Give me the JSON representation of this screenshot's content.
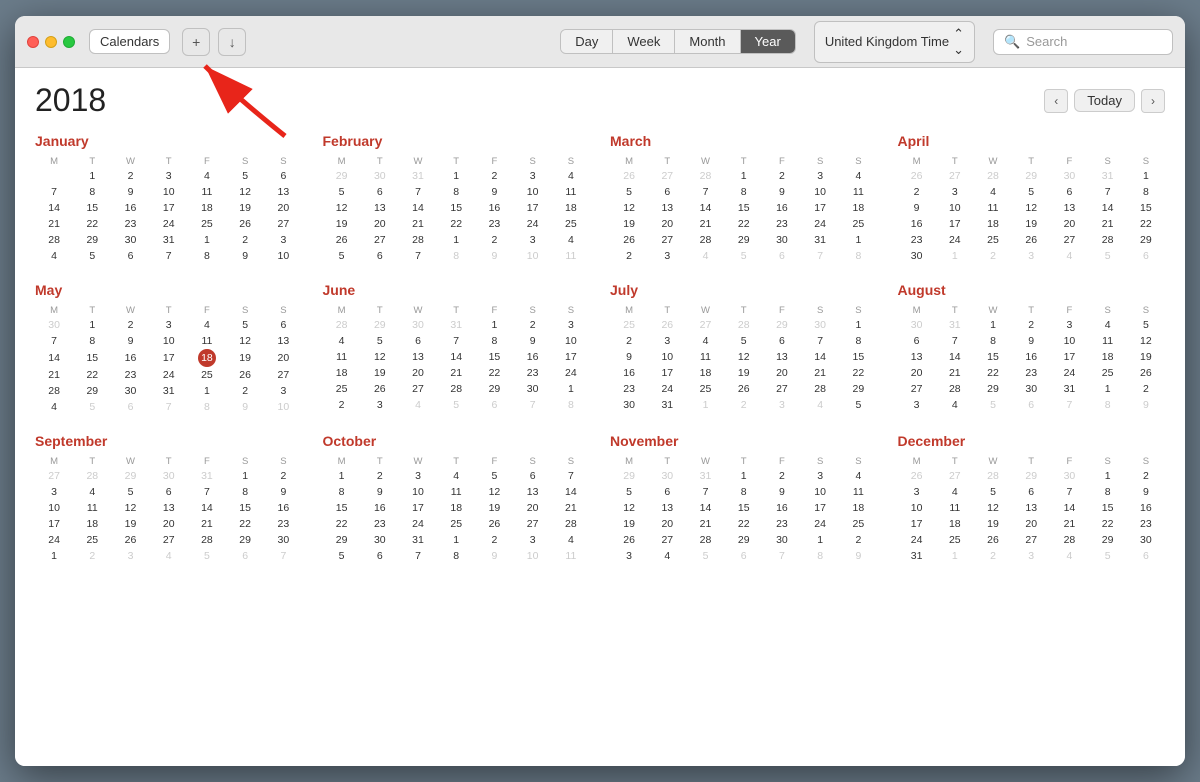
{
  "titlebar": {
    "calendars_label": "Calendars",
    "view_tabs": [
      "Day",
      "Week",
      "Month",
      "Year"
    ],
    "active_tab": "Year",
    "timezone_label": "United Kingdom Time",
    "search_placeholder": "Search"
  },
  "year": "2018",
  "nav": {
    "today_label": "Today"
  },
  "months": [
    {
      "name": "January",
      "days_header": [
        "M",
        "T",
        "W",
        "T",
        "F",
        "S",
        "S"
      ],
      "weeks": [
        [
          "",
          "1",
          "2",
          "3",
          "4",
          "5",
          "6"
        ],
        [
          "7",
          "8",
          "9",
          "10",
          "11",
          "12",
          "13"
        ],
        [
          "14",
          "15",
          "16",
          "17",
          "18",
          "19",
          "20"
        ],
        [
          "21",
          "22",
          "23",
          "24",
          "25",
          "26",
          "27"
        ],
        [
          "28",
          "29",
          "30",
          "31",
          "1",
          "2",
          "3"
        ],
        [
          "4",
          "5",
          "6",
          "7",
          "8",
          "9",
          "10"
        ]
      ],
      "other_month_before": [],
      "other_month_after": [
        "1",
        "2",
        "3",
        "4",
        "5",
        "6",
        "7",
        "8",
        "9",
        "10"
      ]
    },
    {
      "name": "February",
      "days_header": [
        "M",
        "T",
        "W",
        "T",
        "F",
        "S",
        "S"
      ],
      "weeks": [
        [
          "29",
          "30",
          "31",
          "1",
          "2",
          "3",
          "4"
        ],
        [
          "5",
          "6",
          "7",
          "8",
          "9",
          "10",
          "11"
        ],
        [
          "12",
          "13",
          "14",
          "15",
          "16",
          "17",
          "18"
        ],
        [
          "19",
          "20",
          "21",
          "22",
          "23",
          "24",
          "25"
        ],
        [
          "26",
          "27",
          "28",
          "1",
          "2",
          "3",
          "4"
        ],
        [
          "5",
          "6",
          "7",
          "8",
          "9",
          "10",
          "11"
        ]
      ]
    },
    {
      "name": "March",
      "days_header": [
        "M",
        "T",
        "W",
        "T",
        "F",
        "S",
        "S"
      ],
      "weeks": [
        [
          "26",
          "27",
          "28",
          "1",
          "2",
          "3",
          "4"
        ],
        [
          "5",
          "6",
          "7",
          "8",
          "9",
          "10",
          "11"
        ],
        [
          "12",
          "13",
          "14",
          "15",
          "16",
          "17",
          "18"
        ],
        [
          "19",
          "20",
          "21",
          "22",
          "23",
          "24",
          "25"
        ],
        [
          "26",
          "27",
          "28",
          "29",
          "30",
          "31",
          "1"
        ],
        [
          "2",
          "3",
          "4",
          "5",
          "6",
          "7",
          "8"
        ]
      ]
    },
    {
      "name": "April",
      "days_header": [
        "M",
        "T",
        "W",
        "T",
        "F",
        "S",
        "S"
      ],
      "weeks": [
        [
          "26",
          "27",
          "28",
          "29",
          "30",
          "31",
          "1"
        ],
        [
          "2",
          "3",
          "4",
          "5",
          "6",
          "7",
          "8"
        ],
        [
          "9",
          "10",
          "11",
          "12",
          "13",
          "14",
          "15"
        ],
        [
          "16",
          "17",
          "18",
          "19",
          "20",
          "21",
          "22"
        ],
        [
          "23",
          "24",
          "25",
          "26",
          "27",
          "28",
          "29"
        ],
        [
          "30",
          "1",
          "2",
          "3",
          "4",
          "5",
          "6"
        ]
      ]
    },
    {
      "name": "May",
      "days_header": [
        "M",
        "T",
        "W",
        "T",
        "F",
        "S",
        "S"
      ],
      "weeks": [
        [
          "30",
          "1",
          "2",
          "3",
          "4",
          "5",
          "6"
        ],
        [
          "7",
          "8",
          "9",
          "10",
          "11",
          "12",
          "13"
        ],
        [
          "14",
          "15",
          "16",
          "17",
          "18",
          "19",
          "20"
        ],
        [
          "21",
          "22",
          "23",
          "24",
          "25",
          "26",
          "27"
        ],
        [
          "28",
          "29",
          "30",
          "31",
          "1",
          "2",
          "3"
        ],
        [
          "4",
          "5",
          "6",
          "7",
          "8",
          "9",
          "10"
        ]
      ]
    },
    {
      "name": "June",
      "days_header": [
        "M",
        "T",
        "W",
        "T",
        "F",
        "S",
        "S"
      ],
      "weeks": [
        [
          "28",
          "29",
          "30",
          "31",
          "1",
          "2",
          "3"
        ],
        [
          "4",
          "5",
          "6",
          "7",
          "8",
          "9",
          "10"
        ],
        [
          "11",
          "12",
          "13",
          "14",
          "15",
          "16",
          "17"
        ],
        [
          "18",
          "19",
          "20",
          "21",
          "22",
          "23",
          "24"
        ],
        [
          "25",
          "26",
          "27",
          "28",
          "29",
          "30",
          "1"
        ],
        [
          "2",
          "3",
          "4",
          "5",
          "6",
          "7",
          "8"
        ]
      ]
    },
    {
      "name": "July",
      "days_header": [
        "M",
        "T",
        "W",
        "T",
        "F",
        "S",
        "S"
      ],
      "weeks": [
        [
          "25",
          "26",
          "27",
          "28",
          "29",
          "30",
          "1"
        ],
        [
          "2",
          "3",
          "4",
          "5",
          "6",
          "7",
          "8"
        ],
        [
          "9",
          "10",
          "11",
          "12",
          "13",
          "14",
          "15"
        ],
        [
          "16",
          "17",
          "18",
          "19",
          "20",
          "21",
          "22"
        ],
        [
          "23",
          "24",
          "25",
          "26",
          "27",
          "28",
          "29"
        ],
        [
          "30",
          "31",
          "1",
          "2",
          "3",
          "4",
          "5"
        ]
      ]
    },
    {
      "name": "August",
      "days_header": [
        "M",
        "T",
        "W",
        "T",
        "F",
        "S",
        "S"
      ],
      "weeks": [
        [
          "30",
          "31",
          "1",
          "2",
          "3",
          "4",
          "5"
        ],
        [
          "6",
          "7",
          "8",
          "9",
          "10",
          "11",
          "12"
        ],
        [
          "13",
          "14",
          "15",
          "16",
          "17",
          "18",
          "19"
        ],
        [
          "20",
          "21",
          "22",
          "23",
          "24",
          "25",
          "26"
        ],
        [
          "27",
          "28",
          "29",
          "30",
          "31",
          "1",
          "2"
        ],
        [
          "3",
          "4",
          "5",
          "6",
          "7",
          "8",
          "9"
        ]
      ]
    },
    {
      "name": "September",
      "days_header": [
        "M",
        "T",
        "W",
        "T",
        "F",
        "S",
        "S"
      ],
      "weeks": [
        [
          "27",
          "28",
          "29",
          "30",
          "31",
          "1",
          "2"
        ],
        [
          "3",
          "4",
          "5",
          "6",
          "7",
          "8",
          "9"
        ],
        [
          "10",
          "11",
          "12",
          "13",
          "14",
          "15",
          "16"
        ],
        [
          "17",
          "18",
          "19",
          "20",
          "21",
          "22",
          "23"
        ],
        [
          "24",
          "25",
          "26",
          "27",
          "28",
          "29",
          "30"
        ],
        [
          "1",
          "2",
          "3",
          "4",
          "5",
          "6",
          "7"
        ]
      ]
    },
    {
      "name": "October",
      "days_header": [
        "M",
        "T",
        "W",
        "T",
        "F",
        "S",
        "S"
      ],
      "weeks": [
        [
          "1",
          "2",
          "3",
          "4",
          "5",
          "6",
          "7"
        ],
        [
          "8",
          "9",
          "10",
          "11",
          "12",
          "13",
          "14"
        ],
        [
          "15",
          "16",
          "17",
          "18",
          "19",
          "20",
          "21"
        ],
        [
          "22",
          "23",
          "24",
          "25",
          "26",
          "27",
          "28"
        ],
        [
          "29",
          "30",
          "31",
          "1",
          "2",
          "3",
          "4"
        ],
        [
          "5",
          "6",
          "7",
          "8",
          "9",
          "10",
          "11"
        ]
      ]
    },
    {
      "name": "November",
      "days_header": [
        "M",
        "T",
        "W",
        "T",
        "F",
        "S",
        "S"
      ],
      "weeks": [
        [
          "29",
          "30",
          "31",
          "1",
          "2",
          "3",
          "4"
        ],
        [
          "5",
          "6",
          "7",
          "8",
          "9",
          "10",
          "11"
        ],
        [
          "12",
          "13",
          "14",
          "15",
          "16",
          "17",
          "18"
        ],
        [
          "19",
          "20",
          "21",
          "22",
          "23",
          "24",
          "25"
        ],
        [
          "26",
          "27",
          "28",
          "29",
          "30",
          "1",
          "2"
        ],
        [
          "3",
          "4",
          "5",
          "6",
          "7",
          "8",
          "9"
        ]
      ]
    },
    {
      "name": "December",
      "days_header": [
        "M",
        "T",
        "W",
        "T",
        "F",
        "S",
        "S"
      ],
      "weeks": [
        [
          "26",
          "27",
          "28",
          "29",
          "30",
          "1",
          "2"
        ],
        [
          "3",
          "4",
          "5",
          "6",
          "7",
          "8",
          "9"
        ],
        [
          "10",
          "11",
          "12",
          "13",
          "14",
          "15",
          "16"
        ],
        [
          "17",
          "18",
          "19",
          "20",
          "21",
          "22",
          "23"
        ],
        [
          "24",
          "25",
          "26",
          "27",
          "28",
          "29",
          "30"
        ],
        [
          "31",
          "1",
          "2",
          "3",
          "4",
          "5",
          "6"
        ]
      ]
    }
  ],
  "today": {
    "month": 4,
    "day": 18
  }
}
